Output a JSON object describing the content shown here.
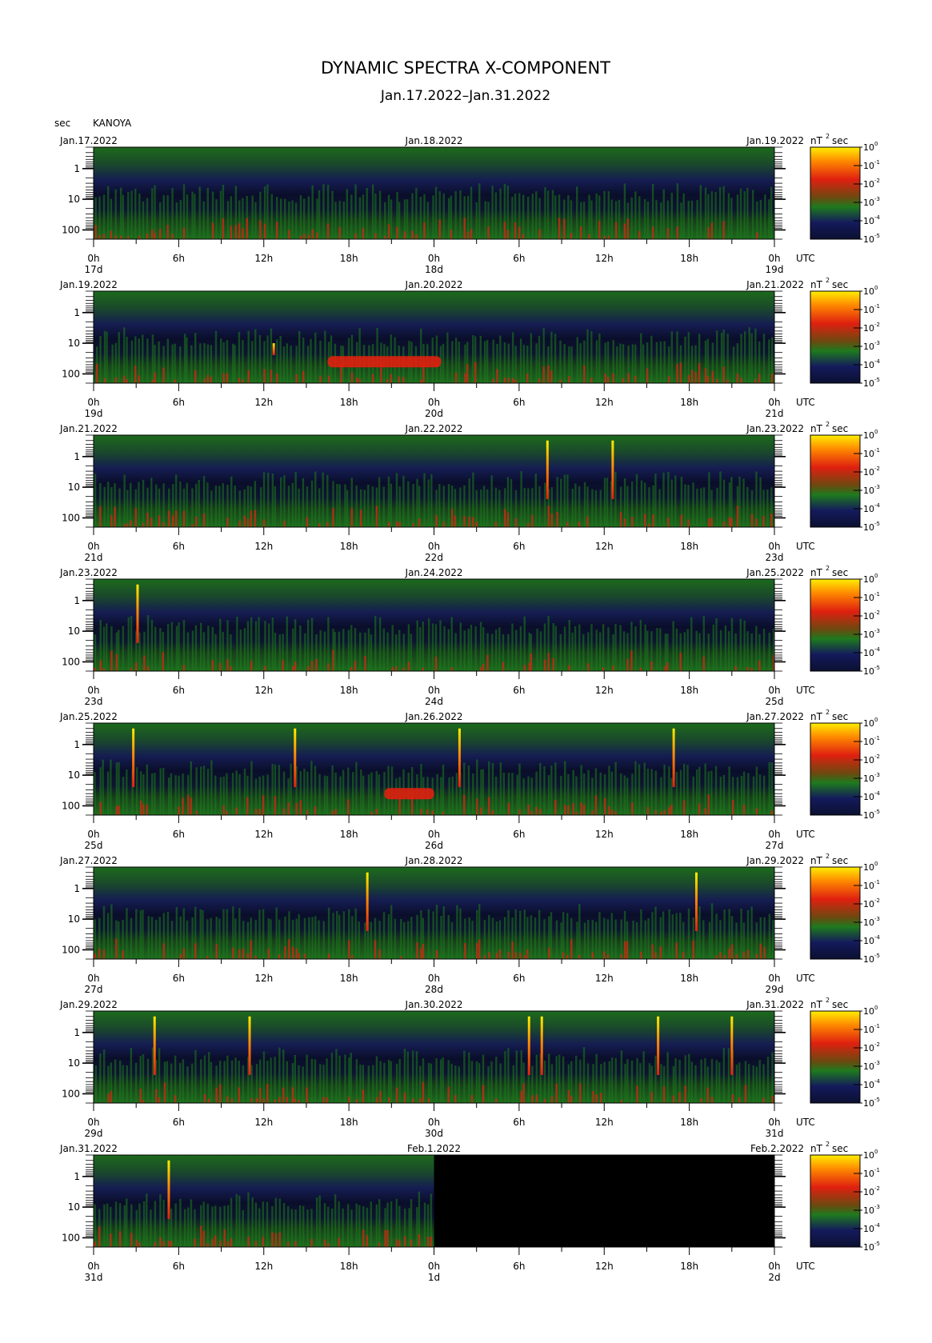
{
  "title": "DYNAMIC SPECTRA X-COMPONENT",
  "subtitle": "Jan.17.2022–Jan.31.2022",
  "ylabel": "sec",
  "station": "KANOYA",
  "colorbar_unit_base": "nT",
  "colorbar_unit_exp": "2",
  "colorbar_unit_tail": "sec",
  "colorbar_base": "10",
  "colorbar_exponents": [
    "0",
    "-1",
    "-2",
    "-3",
    "-4",
    "-5"
  ],
  "colors": {
    "dark": "#0b1030",
    "navy": "#141a5c",
    "green": "#1e7a1e",
    "red": "#e02010",
    "orange": "#ff8a00",
    "yellow": "#ffee00",
    "nodata": "#000000"
  },
  "chart_data": {
    "type": "heatmap",
    "yaxis": {
      "label": "sec",
      "scale": "log",
      "range": [
        0.2,
        200
      ],
      "reversed": true,
      "tick_labels": [
        "1",
        "10",
        "100"
      ]
    },
    "xaxis": {
      "label": "UTC",
      "tick_labels": [
        "0h",
        "6h",
        "12h",
        "18h",
        "0h",
        "6h",
        "12h",
        "18h",
        "0h"
      ]
    },
    "colorscale": {
      "min_exp": -5,
      "max_exp": 0
    },
    "panels": [
      {
        "left_date": "Jan.17.2022",
        "mid_date": "Jan.18.2022",
        "right_date": "Jan.19.2022",
        "day_labels": [
          "17d",
          "18d",
          "19d"
        ],
        "data_end_h": 48,
        "spikes": [],
        "bands": []
      },
      {
        "left_date": "Jan.19.2022",
        "mid_date": "Jan.20.2022",
        "right_date": "Jan.21.2022",
        "day_labels": [
          "19d",
          "20d",
          "21d"
        ],
        "data_end_h": 48,
        "spikes": [
          {
            "t_h": 12.7,
            "top_s": 10
          }
        ],
        "bands": [
          {
            "start_h": 16.5,
            "end_h": 24.5,
            "period_s": 40
          }
        ]
      },
      {
        "left_date": "Jan.21.2022",
        "mid_date": "Jan.22.2022",
        "right_date": "Jan.23.2022",
        "day_labels": [
          "21d",
          "22d",
          "23d"
        ],
        "data_end_h": 48,
        "spikes": [
          {
            "t_h": 32.0,
            "top_s": 0.3
          },
          {
            "t_h": 36.6,
            "top_s": 0.3
          }
        ],
        "bands": []
      },
      {
        "left_date": "Jan.23.2022",
        "mid_date": "Jan.24.2022",
        "right_date": "Jan.25.2022",
        "day_labels": [
          "23d",
          "24d",
          "25d"
        ],
        "data_end_h": 48,
        "spikes": [
          {
            "t_h": 3.1,
            "top_s": 0.3
          }
        ],
        "bands": []
      },
      {
        "left_date": "Jan.25.2022",
        "mid_date": "Jan.26.2022",
        "right_date": "Jan.27.2022",
        "day_labels": [
          "25d",
          "26d",
          "27d"
        ],
        "data_end_h": 48,
        "spikes": [
          {
            "t_h": 2.8,
            "top_s": 0.3
          },
          {
            "t_h": 14.2,
            "top_s": 0.3
          },
          {
            "t_h": 25.8,
            "top_s": 0.3
          },
          {
            "t_h": 40.9,
            "top_s": 0.3
          }
        ],
        "bands": [
          {
            "start_h": 20.5,
            "end_h": 24.0,
            "period_s": 40
          }
        ]
      },
      {
        "left_date": "Jan.27.2022",
        "mid_date": "Jan.28.2022",
        "right_date": "Jan.29.2022",
        "day_labels": [
          "27d",
          "28d",
          "29d"
        ],
        "data_end_h": 48,
        "spikes": [
          {
            "t_h": 19.3,
            "top_s": 0.3
          },
          {
            "t_h": 42.5,
            "top_s": 0.3
          }
        ],
        "bands": []
      },
      {
        "left_date": "Jan.29.2022",
        "mid_date": "Jan.30.2022",
        "right_date": "Jan.31.2022",
        "day_labels": [
          "29d",
          "30d",
          "31d"
        ],
        "data_end_h": 48,
        "spikes": [
          {
            "t_h": 4.3,
            "top_s": 0.3
          },
          {
            "t_h": 11.0,
            "top_s": 0.3
          },
          {
            "t_h": 30.7,
            "top_s": 0.3
          },
          {
            "t_h": 31.6,
            "top_s": 0.3
          },
          {
            "t_h": 39.8,
            "top_s": 0.3
          },
          {
            "t_h": 45.0,
            "top_s": 0.3
          }
        ],
        "bands": []
      },
      {
        "left_date": "Jan.31.2022",
        "mid_date": "Feb.1.2022",
        "right_date": "Feb.2.2022",
        "day_labels": [
          "31d",
          "1d",
          "2d"
        ],
        "data_end_h": 24,
        "spikes": [
          {
            "t_h": 5.3,
            "top_s": 0.3
          }
        ],
        "bands": []
      }
    ]
  }
}
